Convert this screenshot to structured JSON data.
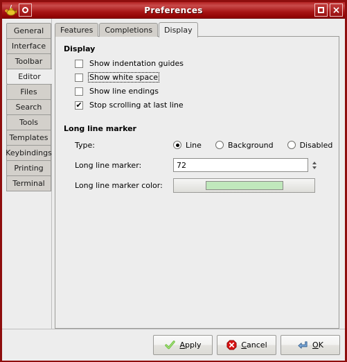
{
  "window": {
    "title": "Preferences",
    "app_icon": "genie-lamp-icon",
    "titlebar_buttons": {
      "menu_label": "",
      "maximize_label": "",
      "close_label": "×"
    },
    "accent_color": "#8b0000",
    "titlebar_gradient_top": "#c94b4b",
    "titlebar_gradient_bottom": "#8b0000",
    "panel_bg": "#ededed"
  },
  "sidebar": {
    "items": [
      {
        "label": "General",
        "selected": false
      },
      {
        "label": "Interface",
        "selected": false
      },
      {
        "label": "Toolbar",
        "selected": false
      },
      {
        "label": "Editor",
        "selected": true
      },
      {
        "label": "Files",
        "selected": false
      },
      {
        "label": "Search",
        "selected": false
      },
      {
        "label": "Tools",
        "selected": false
      },
      {
        "label": "Templates",
        "selected": false
      },
      {
        "label": "Keybindings",
        "selected": false
      },
      {
        "label": "Printing",
        "selected": false
      },
      {
        "label": "Terminal",
        "selected": false
      }
    ]
  },
  "tabs": [
    {
      "label": "Features",
      "active": false
    },
    {
      "label": "Completions",
      "active": false
    },
    {
      "label": "Display",
      "active": true
    }
  ],
  "display_section": {
    "title": "Display",
    "checkboxes": [
      {
        "label": "Show indentation guides",
        "checked": false,
        "focused": false
      },
      {
        "label": "Show white space",
        "checked": false,
        "focused": true
      },
      {
        "label": "Show line endings",
        "checked": false,
        "focused": false
      },
      {
        "label": "Stop scrolling at last line",
        "checked": true,
        "focused": false
      }
    ],
    "check_mark": "✔"
  },
  "long_line_section": {
    "title": "Long line marker",
    "type_label": "Type:",
    "type_options": [
      {
        "label": "Line",
        "selected": true
      },
      {
        "label": "Background",
        "selected": false
      },
      {
        "label": "Disabled",
        "selected": false
      }
    ],
    "marker_label": "Long line marker:",
    "marker_value": "72",
    "color_label": "Long line marker color:",
    "color_value": "#c0e8bc"
  },
  "actions": [
    {
      "name": "apply",
      "label_pre": "",
      "label_mnemonic": "A",
      "label_post": "pply",
      "icon": "green-check-icon"
    },
    {
      "name": "cancel",
      "label_pre": "",
      "label_mnemonic": "C",
      "label_post": "ancel",
      "icon": "red-stop-icon"
    },
    {
      "name": "ok",
      "label_pre": "",
      "label_mnemonic": "O",
      "label_post": "K",
      "icon": "blue-enter-arrow-icon"
    }
  ]
}
